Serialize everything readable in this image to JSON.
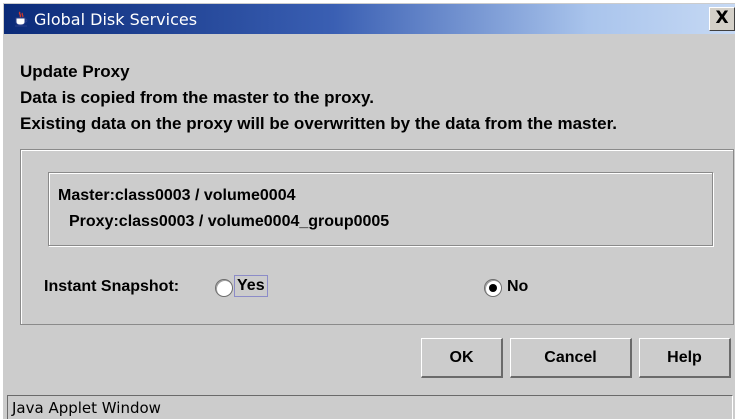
{
  "window": {
    "title": "Global Disk Services",
    "title_icon": "java-cup-icon",
    "close_label": "X"
  },
  "message": {
    "heading": "Update Proxy",
    "line1": "Data is copied from the master to the proxy.",
    "line2": "Existing data on the proxy will be overwritten by the data from the master."
  },
  "info": {
    "master": "Master:class0003 / volume0004",
    "proxy": "Proxy:class0003 / volume0004_group0005"
  },
  "snapshot": {
    "label": "Instant Snapshot:",
    "options": [
      {
        "label": "Yes",
        "selected": false
      },
      {
        "label": "No",
        "selected": true
      }
    ]
  },
  "buttons": {
    "ok": "OK",
    "cancel": "Cancel",
    "help": "Help"
  },
  "status_bar": {
    "text": "Java Applet Window"
  }
}
